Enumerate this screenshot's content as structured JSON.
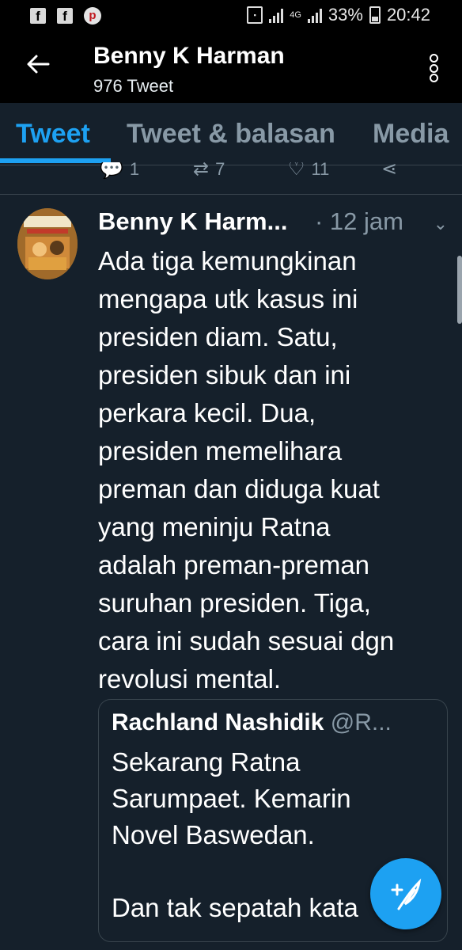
{
  "status_bar": {
    "notif_icons": [
      "facebook-icon",
      "facebook-icon",
      "pinterest-icon"
    ],
    "battery": "33%",
    "time": "20:42",
    "network": "4G"
  },
  "header": {
    "name": "Benny K Harman",
    "tweet_count": "976 Tweet"
  },
  "tabs": [
    {
      "label": "Tweet",
      "active": true
    },
    {
      "label": "Tweet & balasan",
      "active": false
    },
    {
      "label": "Media",
      "active": false
    }
  ],
  "prev_tweet_actions": {
    "replies": "1",
    "retweets": "7",
    "likes": "11"
  },
  "tweet": {
    "name": "Benny K Harm...",
    "time": "· 12 jam",
    "text": "Ada tiga kemungkinan mengapa utk kasus ini presiden diam. Satu, presiden sibuk dan ini perkara kecil. Dua, presiden memelihara preman dan diduga kuat yang meninju Ratna adalah preman-preman suruhan presiden. Tiga, cara ini sudah sesuai dgn revolusi mental.",
    "text_lines": [
      "Ada tiga kemungkinan",
      "mengapa utk kasus ini",
      "presiden diam. Satu,",
      "presiden sibuk dan ini",
      "perkara kecil. Dua,",
      "presiden memelihara",
      "preman dan diduga kuat",
      "yang meninju Ratna",
      "adalah preman-preman",
      "suruhan presiden. Tiga,",
      "cara ini sudah sesuai dgn",
      "revolusi mental."
    ]
  },
  "quoted_tweet": {
    "name": "Rachland Nashidik",
    "handle": "@R...",
    "text_lines": [
      "Sekarang Ratna",
      "Sarumpaet. Kemarin",
      "Novel Baswedan.",
      "",
      "Dan tak sepatah kata"
    ]
  },
  "colors": {
    "background": "#15202b",
    "accent": "#1da1f2",
    "secondary_text": "#8899a6",
    "divider": "#38444d"
  }
}
